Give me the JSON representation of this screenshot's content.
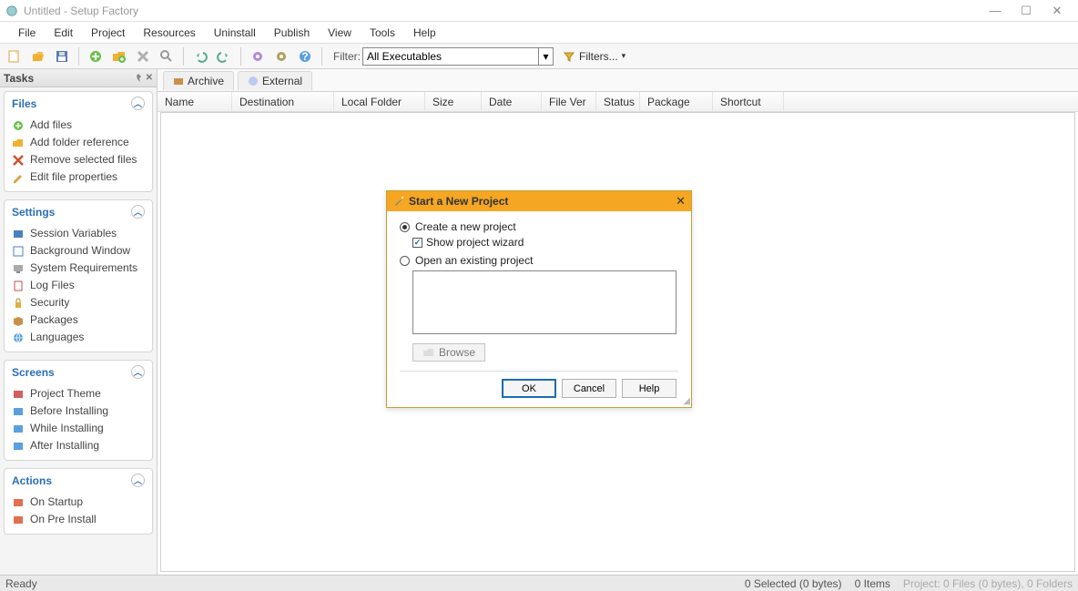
{
  "window": {
    "title": "Untitled - Setup Factory"
  },
  "menu": [
    "File",
    "Edit",
    "Project",
    "Resources",
    "Uninstall",
    "Publish",
    "View",
    "Tools",
    "Help"
  ],
  "filter": {
    "label": "Filter:",
    "selected": "All Executables",
    "filters_btn": "Filters..."
  },
  "sidebar": {
    "header": "Tasks",
    "files": {
      "title": "Files",
      "items": [
        "Add files",
        "Add folder reference",
        "Remove selected files",
        "Edit file properties"
      ]
    },
    "settings": {
      "title": "Settings",
      "items": [
        "Session Variables",
        "Background Window",
        "System Requirements",
        "Log Files",
        "Security",
        "Packages",
        "Languages"
      ]
    },
    "screens": {
      "title": "Screens",
      "items": [
        "Project Theme",
        "Before Installing",
        "While Installing",
        "After Installing"
      ]
    },
    "actions": {
      "title": "Actions",
      "items": [
        "On Startup",
        "On Pre Install"
      ]
    }
  },
  "tabs": {
    "archive": "Archive",
    "external": "External"
  },
  "columns": [
    "Name",
    "Destination",
    "Local Folder",
    "Size",
    "Date",
    "File Ver",
    "Status",
    "Package",
    "Shortcut"
  ],
  "status": {
    "ready": "Ready",
    "selected": "0 Selected (0 bytes)",
    "items": "0 Items",
    "project": "Project: 0 Files (0 bytes), 0 Folders"
  },
  "dialog": {
    "title": "Start a New Project",
    "option_create": "Create a new project",
    "option_show_wizard": "Show project wizard",
    "option_open": "Open an existing project",
    "browse": "Browse",
    "ok": "OK",
    "cancel": "Cancel",
    "help": "Help"
  }
}
